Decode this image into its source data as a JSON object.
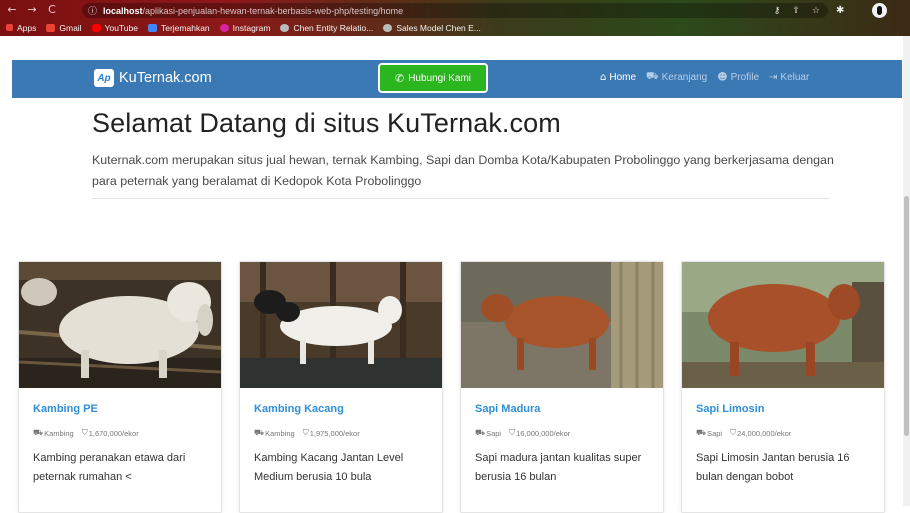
{
  "browser": {
    "url_host": "localhost",
    "url_path": "/aplikasi-penjualan-hewan-ternak-berbasis-web-php/testing/home",
    "nav_back": "←",
    "nav_forward": "→",
    "nav_reload": "C",
    "info_icon": "ⓘ",
    "key_icon": "⚷",
    "share_icon": "⇪",
    "star_icon": "☆",
    "bookmarks": [
      {
        "label": "Apps",
        "color": "#e8423b"
      },
      {
        "label": "Gmail",
        "color": "#ea4335"
      },
      {
        "label": "YouTube",
        "color": "#ff0000"
      },
      {
        "label": "Terjemahkan",
        "color": "#4285f4"
      },
      {
        "label": "Instagram",
        "color": "#d6249f"
      },
      {
        "label": "Chen Entity Relatio...",
        "color": "#bbbbbb"
      },
      {
        "label": "Sales Model Chen E...",
        "color": "#bbbbbb"
      }
    ]
  },
  "navbar": {
    "brand_logo": "Ap",
    "brand": "KuTernak.com",
    "whatsapp_button": "Hubungi Kami",
    "whatsapp_icon": "✆",
    "links": [
      {
        "label": "Home",
        "icon": "home-icon",
        "glyph": "⌂",
        "active": true
      },
      {
        "label": "Keranjang",
        "icon": "cart-icon",
        "glyph": "⛟",
        "active": false
      },
      {
        "label": "Profile",
        "icon": "user-icon",
        "glyph": "☻",
        "active": false
      },
      {
        "label": "Keluar",
        "icon": "sign-out-icon",
        "glyph": "⇥",
        "active": false
      }
    ],
    "color": "#3b79b4"
  },
  "hero": {
    "title": "Selamat Datang di situs KuTernak.com",
    "lead": "Kuternak.com merupakan situs jual hewan, ternak Kambing, Sapi dan Domba Kota/Kabupaten Probolinggo yang berkerjasama dengan para peternak yang beralamat di Kedopok Kota Probolinggo"
  },
  "products": [
    {
      "name": "Kambing PE",
      "category": "Kambing",
      "price": "1,670,000/ekor",
      "description": "Kambing peranakan etawa dari peternak rumahan <"
    },
    {
      "name": "Kambing Kacang",
      "category": "Kambing",
      "price": "1,975,000/ekor",
      "description": "Kambing Kacang Jantan Level Medium berusia 10 bula"
    },
    {
      "name": "Sapi Madura",
      "category": "Sapi",
      "price": "16,000,000/ekor",
      "description": "Sapi madura jantan kualitas super berusia 16 bulan"
    },
    {
      "name": "Sapi Limosin",
      "category": "Sapi",
      "price": "24,000,000/ekor",
      "description": "Sapi Limosin Jantan berusia 16 bulan dengan bobot"
    }
  ],
  "colors": {
    "link": "#2f8fd8",
    "whatsapp": "#2bb51f"
  }
}
